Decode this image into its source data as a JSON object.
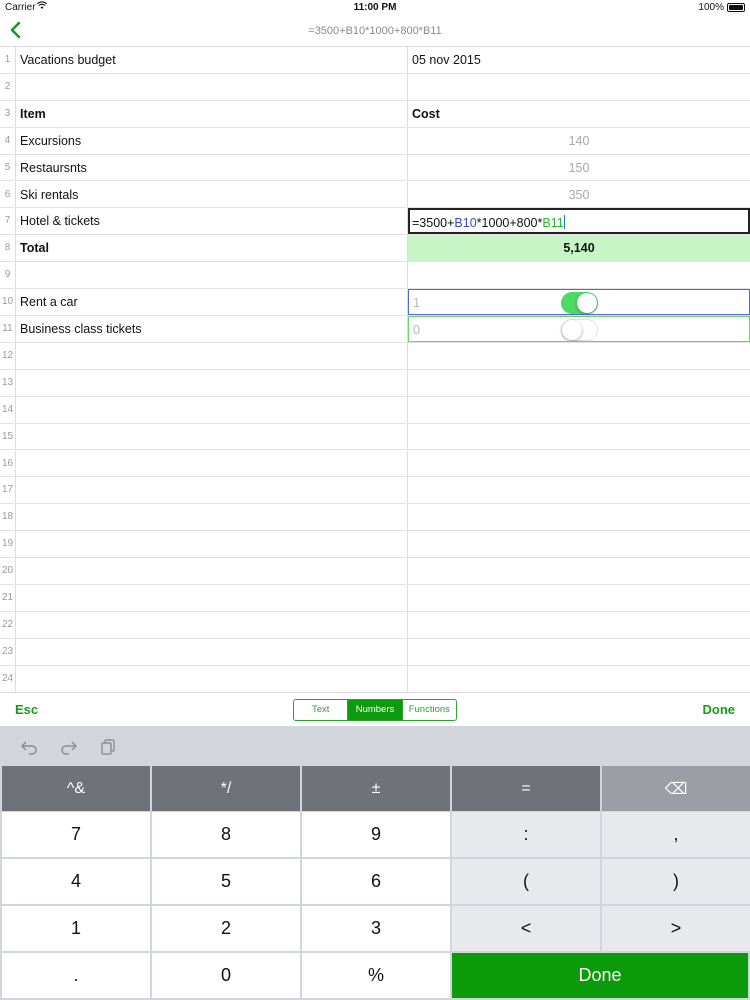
{
  "status": {
    "carrier": "Carrier",
    "time": "11:00 PM",
    "battery": "100%"
  },
  "nav": {
    "formula": "=3500+B10*1000+800*B11"
  },
  "rows": [
    {
      "n": "1",
      "a": "Vacations budget",
      "b": "05 nov 2015"
    },
    {
      "n": "2",
      "a": "",
      "b": ""
    },
    {
      "n": "3",
      "a": "Item",
      "b": "Cost"
    },
    {
      "n": "4",
      "a": "Excursions",
      "b": "140"
    },
    {
      "n": "5",
      "a": "Restaursnts",
      "b": "150"
    },
    {
      "n": "6",
      "a": "Ski rentals",
      "b": "350"
    },
    {
      "n": "7",
      "a": "Hotel & tickets",
      "b": ""
    },
    {
      "n": "8",
      "a": "Total",
      "b": "5,140"
    },
    {
      "n": "9",
      "a": "",
      "b": ""
    },
    {
      "n": "10",
      "a": "Rent a car",
      "b": "1"
    },
    {
      "n": "11",
      "a": "Business class tickets",
      "b": "0"
    },
    {
      "n": "12",
      "a": "",
      "b": ""
    },
    {
      "n": "13",
      "a": "",
      "b": ""
    },
    {
      "n": "14",
      "a": "",
      "b": ""
    },
    {
      "n": "15",
      "a": "",
      "b": ""
    },
    {
      "n": "16",
      "a": "",
      "b": ""
    },
    {
      "n": "17",
      "a": "",
      "b": ""
    },
    {
      "n": "18",
      "a": "",
      "b": ""
    },
    {
      "n": "19",
      "a": "",
      "b": ""
    },
    {
      "n": "20",
      "a": "",
      "b": ""
    },
    {
      "n": "21",
      "a": "",
      "b": ""
    },
    {
      "n": "22",
      "a": "",
      "b": ""
    },
    {
      "n": "23",
      "a": "",
      "b": ""
    },
    {
      "n": "24",
      "a": "",
      "b": ""
    }
  ],
  "editing": {
    "p1": "=3500+",
    "r1": "B10",
    "p2": "*1000+800*",
    "r2": "B11"
  },
  "toggles": {
    "rent_car": true,
    "business": false
  },
  "toolbar": {
    "esc": "Esc",
    "done": "Done",
    "modes": [
      "Text",
      "Numbers",
      "Functions"
    ],
    "active_mode": "Numbers"
  },
  "keyboard": {
    "top": [
      "^&",
      "*/",
      "±",
      "=",
      "⌫"
    ],
    "rows": [
      [
        "7",
        "8",
        "9",
        ":",
        ","
      ],
      [
        "4",
        "5",
        "6",
        "(",
        ")"
      ],
      [
        "1",
        "2",
        "3",
        "<",
        ">"
      ],
      [
        ".",
        "0",
        "%"
      ]
    ],
    "done": "Done"
  },
  "colors": {
    "accent": "#0a9a0a",
    "total_bg": "#c7f5c5",
    "ref_blue": "#3b48d6",
    "ref_green": "#2bb82b"
  }
}
